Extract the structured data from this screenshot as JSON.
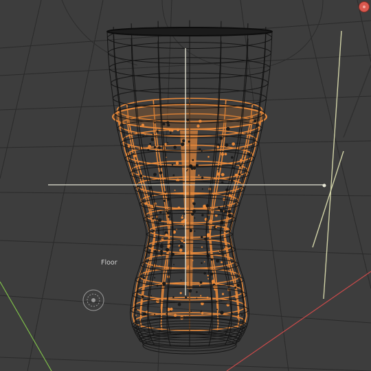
{
  "viewport": {
    "floor_label": "Floor",
    "colors": {
      "background": "#3d3d3d",
      "grid": "#2a2a2a",
      "wireframe": "#141414",
      "liquid": "#e8893a",
      "axis_x": "#c94a4a",
      "axis_y": "#7fbf4a",
      "light_lines": "#d2d4a8",
      "crosshair": "#e6e6d6"
    },
    "icons": [
      "light-probe-icon",
      "gizmo-x-axis-icon"
    ]
  }
}
